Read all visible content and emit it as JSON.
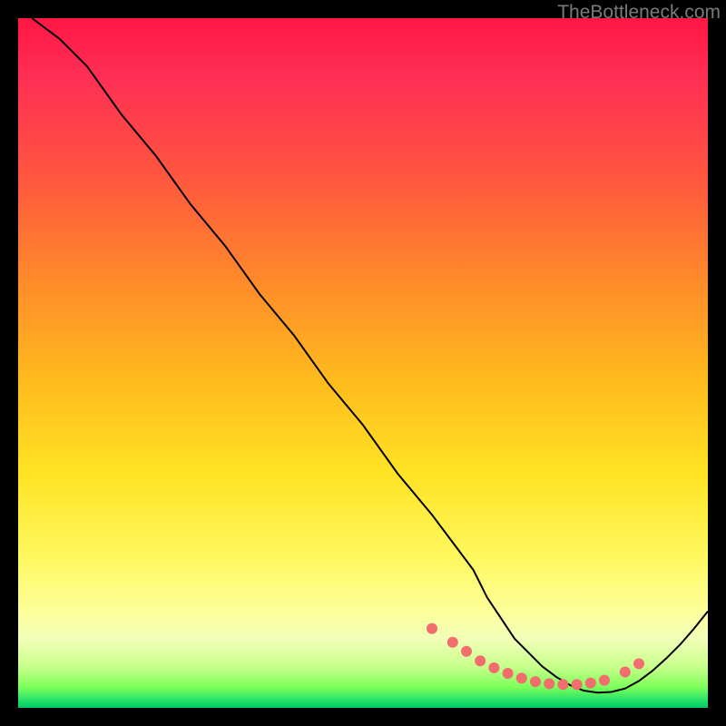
{
  "watermark": "TheBottleneck.com",
  "chart_data": {
    "type": "line",
    "title": "",
    "xlabel": "",
    "ylabel": "",
    "xlim": [
      0,
      100
    ],
    "ylim": [
      0,
      100
    ],
    "grid": false,
    "legend": false,
    "series": [
      {
        "name": "curve",
        "x": [
          2,
          6,
          10,
          15,
          20,
          25,
          30,
          35,
          40,
          45,
          50,
          55,
          60,
          63,
          66,
          68,
          70,
          72,
          74,
          76,
          78,
          80,
          82,
          84,
          86,
          88,
          90,
          92,
          94,
          96,
          98,
          100
        ],
        "values": [
          100,
          97,
          93,
          86,
          80,
          73,
          67,
          60,
          54,
          47,
          41,
          34,
          28,
          24,
          20,
          16,
          13,
          10,
          8,
          6,
          4.5,
          3.3,
          2.5,
          2.2,
          2.3,
          2.8,
          3.9,
          5.4,
          7.2,
          9.2,
          11.5,
          14
        ]
      }
    ],
    "markers": {
      "name": "dots",
      "x": [
        60,
        63,
        65,
        67,
        69,
        71,
        73,
        75,
        77,
        79,
        81,
        83,
        85,
        88,
        90
      ],
      "values": [
        11.5,
        9.5,
        8.2,
        6.8,
        5.8,
        5.0,
        4.3,
        3.8,
        3.5,
        3.4,
        3.4,
        3.6,
        4.0,
        5.2,
        6.4
      ],
      "color": "#f26d6d",
      "radius_px": 6
    },
    "background_gradient": {
      "direction": "vertical",
      "stops": [
        {
          "pos": 0.0,
          "color": "#ff1744"
        },
        {
          "pos": 0.22,
          "color": "#ff5340"
        },
        {
          "pos": 0.52,
          "color": "#ffb91e"
        },
        {
          "pos": 0.78,
          "color": "#fff85e"
        },
        {
          "pos": 0.94,
          "color": "#c8ff8c"
        },
        {
          "pos": 1.0,
          "color": "#00c864"
        }
      ]
    }
  }
}
